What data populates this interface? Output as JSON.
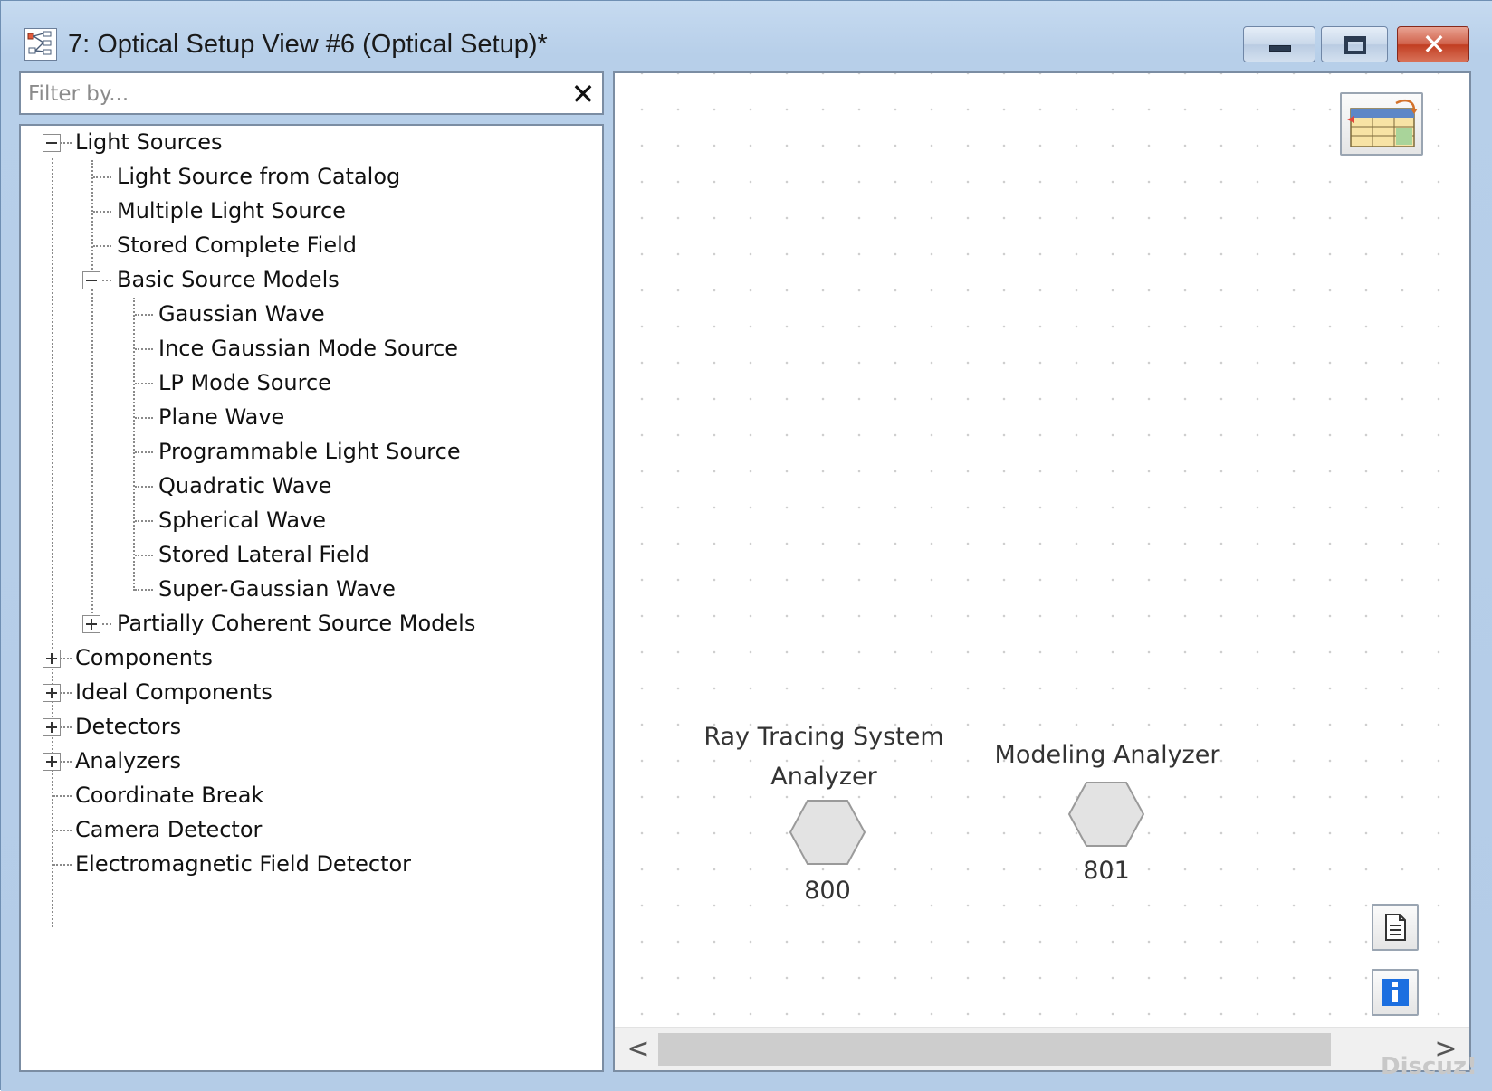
{
  "window": {
    "title": "7: Optical Setup View #6 (Optical Setup)*",
    "close_glyph": "✕"
  },
  "filter": {
    "placeholder": "Filter by...",
    "value": "",
    "clear_glyph": "✕"
  },
  "tree": {
    "items": [
      {
        "label": "Light Sources",
        "level": 0,
        "expander": "expanded"
      },
      {
        "label": "Light Source from Catalog",
        "level": 1,
        "expander": "none"
      },
      {
        "label": "Multiple Light Source",
        "level": 1,
        "expander": "none"
      },
      {
        "label": "Stored Complete Field",
        "level": 1,
        "expander": "none"
      },
      {
        "label": "Basic Source Models",
        "level": 1,
        "expander": "expanded"
      },
      {
        "label": "Gaussian Wave",
        "level": 2,
        "expander": "none"
      },
      {
        "label": "Ince Gaussian Mode Source",
        "level": 2,
        "expander": "none"
      },
      {
        "label": "LP Mode Source",
        "level": 2,
        "expander": "none"
      },
      {
        "label": "Plane Wave",
        "level": 2,
        "expander": "none"
      },
      {
        "label": "Programmable Light Source",
        "level": 2,
        "expander": "none"
      },
      {
        "label": "Quadratic Wave",
        "level": 2,
        "expander": "none"
      },
      {
        "label": "Spherical Wave",
        "level": 2,
        "expander": "none"
      },
      {
        "label": "Stored Lateral Field",
        "level": 2,
        "expander": "none"
      },
      {
        "label": "Super-Gaussian Wave",
        "level": 2,
        "expander": "none"
      },
      {
        "label": "Partially Coherent Source Models",
        "level": 1,
        "expander": "collapsed"
      },
      {
        "label": "Components",
        "level": 0,
        "expander": "collapsed"
      },
      {
        "label": "Ideal Components",
        "level": 0,
        "expander": "collapsed"
      },
      {
        "label": "Detectors",
        "level": 0,
        "expander": "collapsed"
      },
      {
        "label": "Analyzers",
        "level": 0,
        "expander": "collapsed"
      },
      {
        "label": "Coordinate Break",
        "level": 0,
        "expander": "none"
      },
      {
        "label": "Camera Detector",
        "level": 0,
        "expander": "none"
      },
      {
        "label": "Electromagnetic Field Detector",
        "level": 0,
        "expander": "none"
      }
    ]
  },
  "canvas": {
    "nodes": [
      {
        "label_line1": "Ray Tracing System",
        "label_line2": "Analyzer",
        "id": "800"
      },
      {
        "label_line1": "Modeling Analyzer",
        "label_line2": "",
        "id": "801"
      }
    ],
    "node_fill": "#e3e3e3",
    "node_stroke": "#9a9a9a",
    "info_color": "#1c6fe0"
  },
  "scrollbar": {
    "left_glyph": "<",
    "right_glyph": ">",
    "thumb_fraction": 0.88
  },
  "watermark": "Discuz!"
}
